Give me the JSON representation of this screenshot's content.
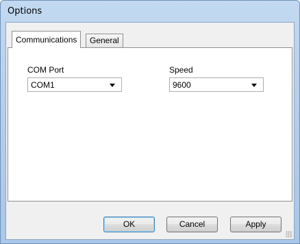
{
  "window": {
    "title": "Options"
  },
  "tabs": [
    {
      "label": "Communications",
      "active": true
    },
    {
      "label": "General",
      "active": false
    }
  ],
  "communications": {
    "com_port": {
      "label": "COM Port",
      "value": "COM1"
    },
    "speed": {
      "label": "Speed",
      "value": "9600"
    }
  },
  "buttons": {
    "ok": "OK",
    "cancel": "Cancel",
    "apply": "Apply"
  },
  "colors": {
    "frame": "#b5cfec",
    "client": "#f0f0f0",
    "default_button_border": "#3c7fb1"
  }
}
